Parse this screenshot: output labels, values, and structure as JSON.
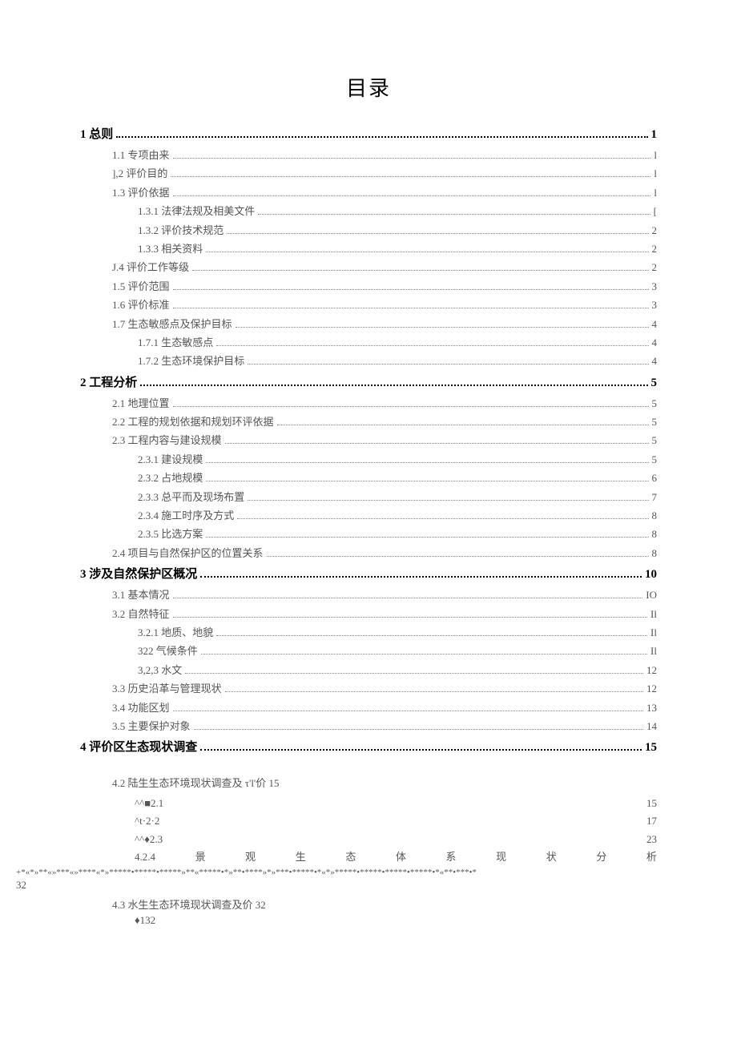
{
  "title": "目录",
  "toc": [
    {
      "level": 1,
      "label": "1 总则",
      "page": "1"
    },
    {
      "level": 2,
      "label": "1.1 专项由来",
      "page": "l"
    },
    {
      "level": 2,
      "label": "],2 评价目的",
      "page": "l"
    },
    {
      "level": 2,
      "label": "1.3 评价依据",
      "page": "l"
    },
    {
      "level": 3,
      "label": "1.3.1 法律法规及相美文件",
      "page": "["
    },
    {
      "level": 3,
      "label": "1.3.2 评价技术规范",
      "page": "2"
    },
    {
      "level": 3,
      "label": "1.3.3 相关资料",
      "page": "2"
    },
    {
      "level": 2,
      "label": "J.4 评价工作等级",
      "page": "2"
    },
    {
      "level": 2,
      "label": "1.5 评价范围",
      "page": "3"
    },
    {
      "level": 2,
      "label": "1.6 评价标准",
      "page": "3"
    },
    {
      "level": 2,
      "label": "1.7 生态敏感点及保护目标",
      "page": "4"
    },
    {
      "level": 3,
      "label": "1.7.1 生态敏感点",
      "page": "4"
    },
    {
      "level": 3,
      "label": "1.7.2 生态环境保护目标",
      "page": "4"
    },
    {
      "level": 1,
      "label": "2 工程分析",
      "page": "5"
    },
    {
      "level": 2,
      "label": "2.1 地理位置",
      "page": "5"
    },
    {
      "level": 2,
      "label": "2.2 工程的规划依据和规划环评依据",
      "page": "5"
    },
    {
      "level": 2,
      "label": "2.3 工程内容与建设规模",
      "page": "5"
    },
    {
      "level": 3,
      "label": "2.3.1 建设规模",
      "page": "5"
    },
    {
      "level": 3,
      "label": "2.3.2 占地规模",
      "page": "6"
    },
    {
      "level": 3,
      "label": "2.3.3 总平而及现场布置",
      "page": "7"
    },
    {
      "level": 3,
      "label": "2.3.4 施工时序及方式",
      "page": "8"
    },
    {
      "level": 3,
      "label": "2.3.5 比选方案",
      "page": "8"
    },
    {
      "level": 2,
      "label": "2.4 项目与自然保护区的位置关系",
      "page": "8"
    },
    {
      "level": 1,
      "label": "3 涉及自然保护区概况",
      "page": "10"
    },
    {
      "level": 2,
      "label": "3.1 基本情况",
      "page": "IO"
    },
    {
      "level": 2,
      "label": "3.2 自然特征",
      "page": "Il"
    },
    {
      "level": 3,
      "label": "3.2.1 地质、地貌",
      "page": "Il"
    },
    {
      "level": 3,
      "label": "322 气候条件",
      "page": "Il"
    },
    {
      "level": 3,
      "label": "3,2,3 水文",
      "page": "12"
    },
    {
      "level": 2,
      "label": "3.3 历史沿革与管理现状",
      "page": "12"
    },
    {
      "level": 2,
      "label": "3.4 功能区划",
      "page": "13"
    },
    {
      "level": 2,
      "label": "3.5 主要保护对象",
      "page": "14"
    },
    {
      "level": 1,
      "label": "4 评价区生态现状调查",
      "page": "15"
    }
  ],
  "section42": {
    "head": "4.2    陆生生态环境现状调查及 τ'l'价 15",
    "rows": [
      {
        "label": "^^■2.1",
        "page": "15"
      },
      {
        "label": "^t·2·2",
        "page": "17"
      },
      {
        "label": "^^♦2.3",
        "page": "23"
      }
    ],
    "row424": [
      "4.2.4",
      "景",
      "观",
      "生",
      "态",
      "体",
      "系",
      "现",
      "状",
      "分",
      "析"
    ],
    "garble": "+*«*»**«»***«»****«*»*****•*****•*****»**«*****•*»**•****»*»***•*****•*«*»*****•*****•*****•*****•*«**•***•*",
    "n32": "32"
  },
  "section43": {
    "head": "4.3    水生生态环境现状调查及价 32",
    "row": {
      "label": "♦1",
      "page": "32"
    }
  }
}
